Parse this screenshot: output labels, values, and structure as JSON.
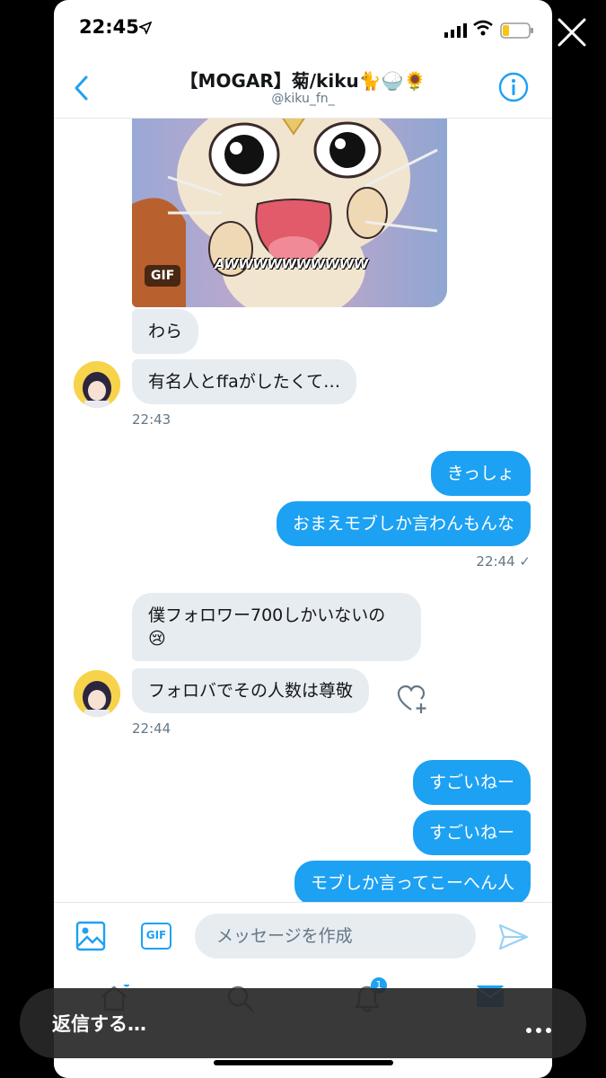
{
  "status_bar": {
    "time": "22:45"
  },
  "header": {
    "title": "【MOGAR】菊/kiku🐈🍚🌻",
    "handle": "@kiku_fn_"
  },
  "gif": {
    "badge": "GIF",
    "caption": "AWWWWWWWWWW"
  },
  "messages": {
    "m1": "わら",
    "m2": "有名人とffaがしたくて…",
    "ts1": "22:43",
    "m3": "きっしょ",
    "m4": "おまえモブしか言わんもんな",
    "ts2": "22:44 ✓",
    "m5_line1": "僕フォロワー700しかいないの",
    "m5_line2": "😢",
    "m6": "フォロバでその人数は尊敬",
    "ts3": "22:44",
    "m7": "すごいねー",
    "m8": "すごいねー",
    "m9": "モブしか言ってこーへん人"
  },
  "composer": {
    "gif_label": "GIF",
    "placeholder": "メッセージを作成"
  },
  "tabbar": {
    "notification_count": "1"
  },
  "overlay": {
    "reply_label": "返信する…"
  },
  "colors": {
    "accent": "#1da1f2",
    "incoming": "#e6ecf0",
    "text": "#14171a",
    "muted": "#657786"
  },
  "icons": [
    "location-arrow-icon",
    "signal-icon",
    "wifi-icon",
    "battery-icon",
    "close-icon",
    "back-chevron-icon",
    "info-icon",
    "heart-plus-icon",
    "image-icon",
    "send-icon",
    "home-icon",
    "search-icon",
    "bell-icon",
    "mail-icon",
    "more-icon"
  ]
}
